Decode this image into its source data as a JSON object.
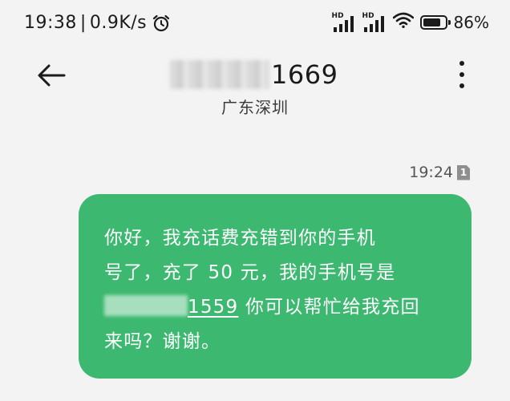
{
  "status_bar": {
    "time": "19:38",
    "separator": "|",
    "net_speed": "0.9K/s",
    "signal1_label": "HD",
    "signal2_label": "HD",
    "battery_percent": "86%",
    "battery_level": 0.86
  },
  "header": {
    "contact_number_suffix": "1669",
    "location": "广东深圳"
  },
  "message": {
    "time": "19:24",
    "sim_slot": "1",
    "line1": "你好，我充话费充错到你的手机",
    "line2": "号了，充了 50 元，我的手机号是",
    "phone_suffix": "1559",
    "line3_rest": " 你可以帮忙给我充回",
    "line4": "来吗？谢谢。"
  },
  "colors": {
    "bubble": "#3cb870",
    "background": "#f3f3f3",
    "text": "#1b1b1b"
  },
  "icons": {
    "alarm": "alarm-clock-icon",
    "signal": "cell-signal-icon",
    "wifi": "wifi-icon",
    "battery": "battery-icon",
    "back": "arrow-left-icon",
    "more": "more-vertical-icon"
  }
}
